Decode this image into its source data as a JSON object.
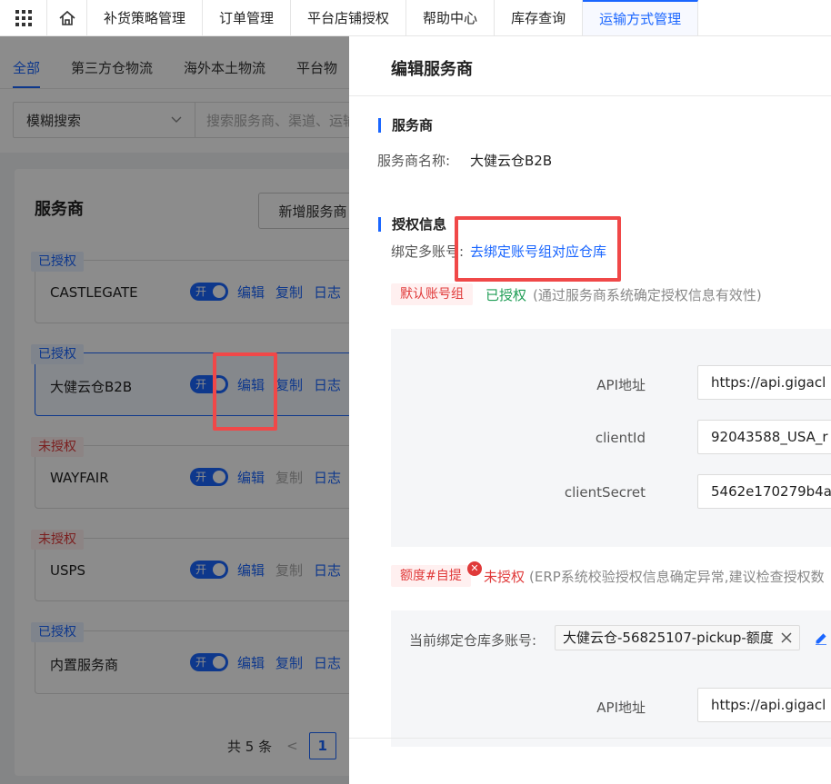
{
  "topnav": {
    "items": [
      {
        "label": "补货策略管理"
      },
      {
        "label": "订单管理"
      },
      {
        "label": "平台店铺授权"
      },
      {
        "label": "帮助中心"
      },
      {
        "label": "库存查询"
      },
      {
        "label": "运输方式管理"
      }
    ]
  },
  "subtabs": [
    "全部",
    "第三方仓物流",
    "海外本土物流",
    "平台物"
  ],
  "search": {
    "select_label": "模糊搜索",
    "placeholder": "搜索服务商、渠道、运输"
  },
  "card": {
    "title": "服务商",
    "add_button": "新增服务商",
    "actions": {
      "toggle": "开",
      "edit": "编辑",
      "copy": "复制",
      "log": "日志"
    },
    "providers": [
      {
        "badge": "已授权",
        "name": "CASTLEGATE",
        "authorized": true,
        "copy_enabled": true
      },
      {
        "badge": "已授权",
        "name": "大健云仓B2B",
        "authorized": true,
        "copy_enabled": true
      },
      {
        "badge": "未授权",
        "name": "WAYFAIR",
        "authorized": false,
        "copy_enabled": false
      },
      {
        "badge": "未授权",
        "name": "USPS",
        "authorized": false,
        "copy_enabled": false
      },
      {
        "badge": "已授权",
        "name": "内置服务商",
        "authorized": true,
        "copy_enabled": true
      }
    ],
    "pager": {
      "total": "共 5 条",
      "prev": "<",
      "page": "1"
    }
  },
  "drawer": {
    "title": "编辑服务商",
    "section_provider": "服务商",
    "provider_name_label": "服务商名称:",
    "provider_name_value": "大健云仓B2B",
    "section_auth": "授权信息",
    "bind_label": "绑定多账号:",
    "bind_link": "去绑定账号组对应仓库",
    "group1": {
      "tag": "默认账号组",
      "status": "已授权",
      "hint": "(通过服务商系统确定授权信息有效性)",
      "fields": [
        {
          "label": "API地址",
          "value": "https://api.gigacl"
        },
        {
          "label": "clientId",
          "value": "92043588_USA_r"
        },
        {
          "label": "clientSecret",
          "value": "5462e170279b4a"
        }
      ]
    },
    "group2": {
      "tag": "额度#自提",
      "err_icon": "✕",
      "status": "未授权",
      "hint": "(ERP系统校验授权信息确定异常,建议检查授权数",
      "bound_label": "当前绑定仓库多账号:",
      "bound_chip": "大健云仓-56825107-pickup-额度",
      "fields": [
        {
          "label": "API地址",
          "value": "https://api.gigacl"
        }
      ]
    }
  },
  "colors": {
    "primary": "#1a66ff",
    "danger": "#e03a3a",
    "success": "#1f9d55",
    "highlight": "#f04848"
  }
}
